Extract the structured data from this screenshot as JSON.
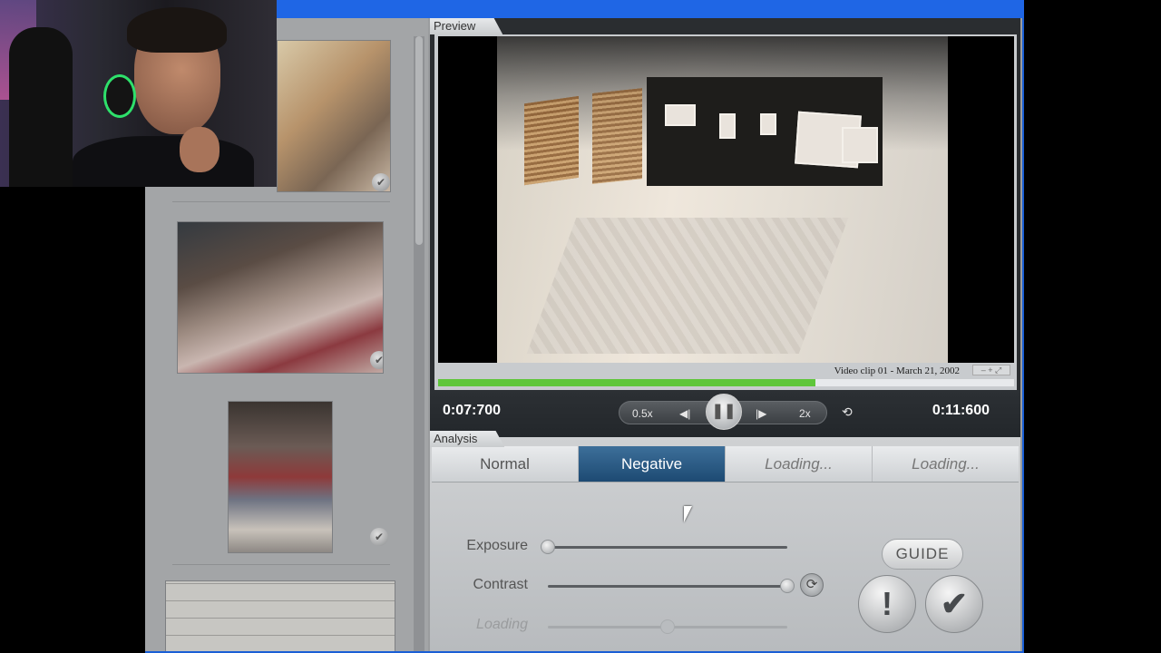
{
  "preview": {
    "section_label": "Preview",
    "caption": "Video clip 01 - March 21, 2002",
    "zoom_label": "– + ⤢",
    "progress": 0.655
  },
  "transport": {
    "current_time": "0:07:700",
    "total_time": "0:11:600",
    "slow_label": "0.5x",
    "fast_label": "2x",
    "prev_icon": "◀|",
    "next_icon": "|▶",
    "pause_icon": "❚❚",
    "loop_icon": "⟲"
  },
  "analysis": {
    "section_label": "Analysis",
    "modes": [
      {
        "label": "Normal",
        "active": false
      },
      {
        "label": "Negative",
        "active": true
      },
      {
        "label": "Loading...",
        "active": false
      },
      {
        "label": "Loading...",
        "active": false
      }
    ],
    "sliders": [
      {
        "label": "Exposure",
        "value": 0.0
      },
      {
        "label": "Contrast",
        "value": 1.0
      },
      {
        "label": "Loading",
        "value": 0.5
      }
    ],
    "reset_icon": "⟳",
    "guide_label": "GUIDE",
    "warn_icon": "!",
    "confirm_icon": "✔"
  },
  "gallery": {
    "check_icon": "✔"
  },
  "colors": {
    "accent_blue": "#1f66e5",
    "progress_green": "#5fc63a",
    "active_mode": "#1d4a73"
  }
}
